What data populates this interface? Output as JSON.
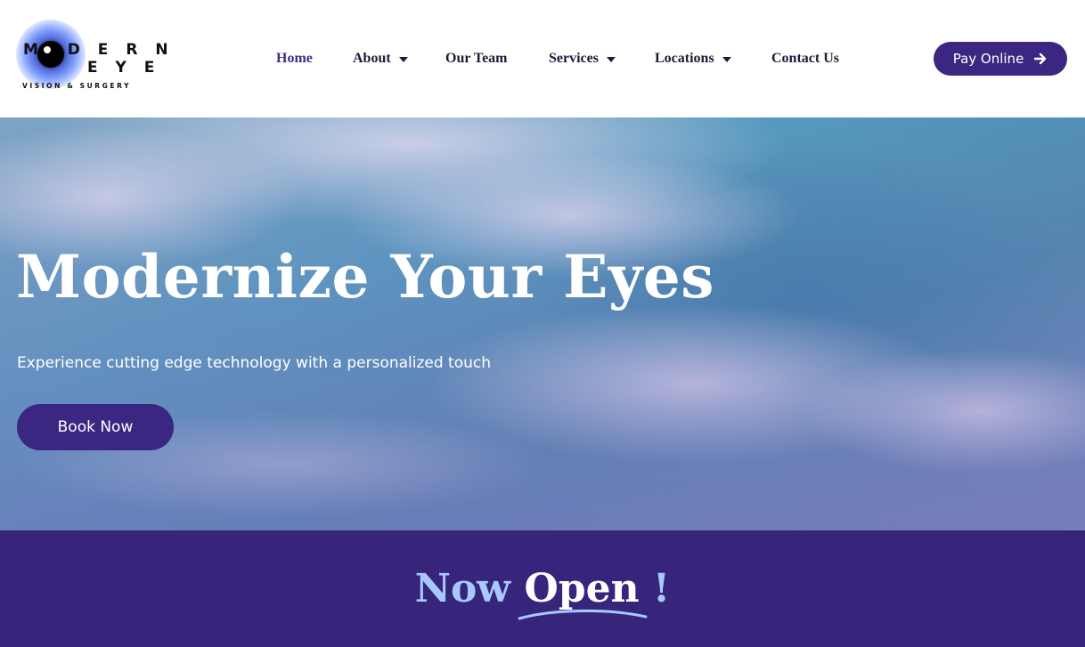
{
  "brand": {
    "logo_line1": "M  D E R N",
    "logo_line2": "E Y E",
    "logo_line3": "VISION & SURGERY",
    "accent_color": "#3b2781"
  },
  "nav": {
    "items": [
      {
        "label": "Home",
        "has_dropdown": false,
        "active": true
      },
      {
        "label": "About",
        "has_dropdown": true
      },
      {
        "label": "Our Team",
        "has_dropdown": false
      },
      {
        "label": "Services",
        "has_dropdown": true
      },
      {
        "label": "Locations",
        "has_dropdown": true
      },
      {
        "label": "Contact Us",
        "has_dropdown": false
      }
    ],
    "pay_label": "Pay Online",
    "pay_icon": "arrow-right-icon"
  },
  "hero": {
    "title": "Modernize Your Eyes",
    "subtitle": "Experience cutting edge technology with a personalized touch",
    "cta_label": "Book Now",
    "background": "ocean-waves-aerial"
  },
  "band": {
    "word1": "Now",
    "word2": "Open",
    "word3": "!",
    "background_color": "#37257c",
    "highlight_color": "#a7c9ff"
  }
}
